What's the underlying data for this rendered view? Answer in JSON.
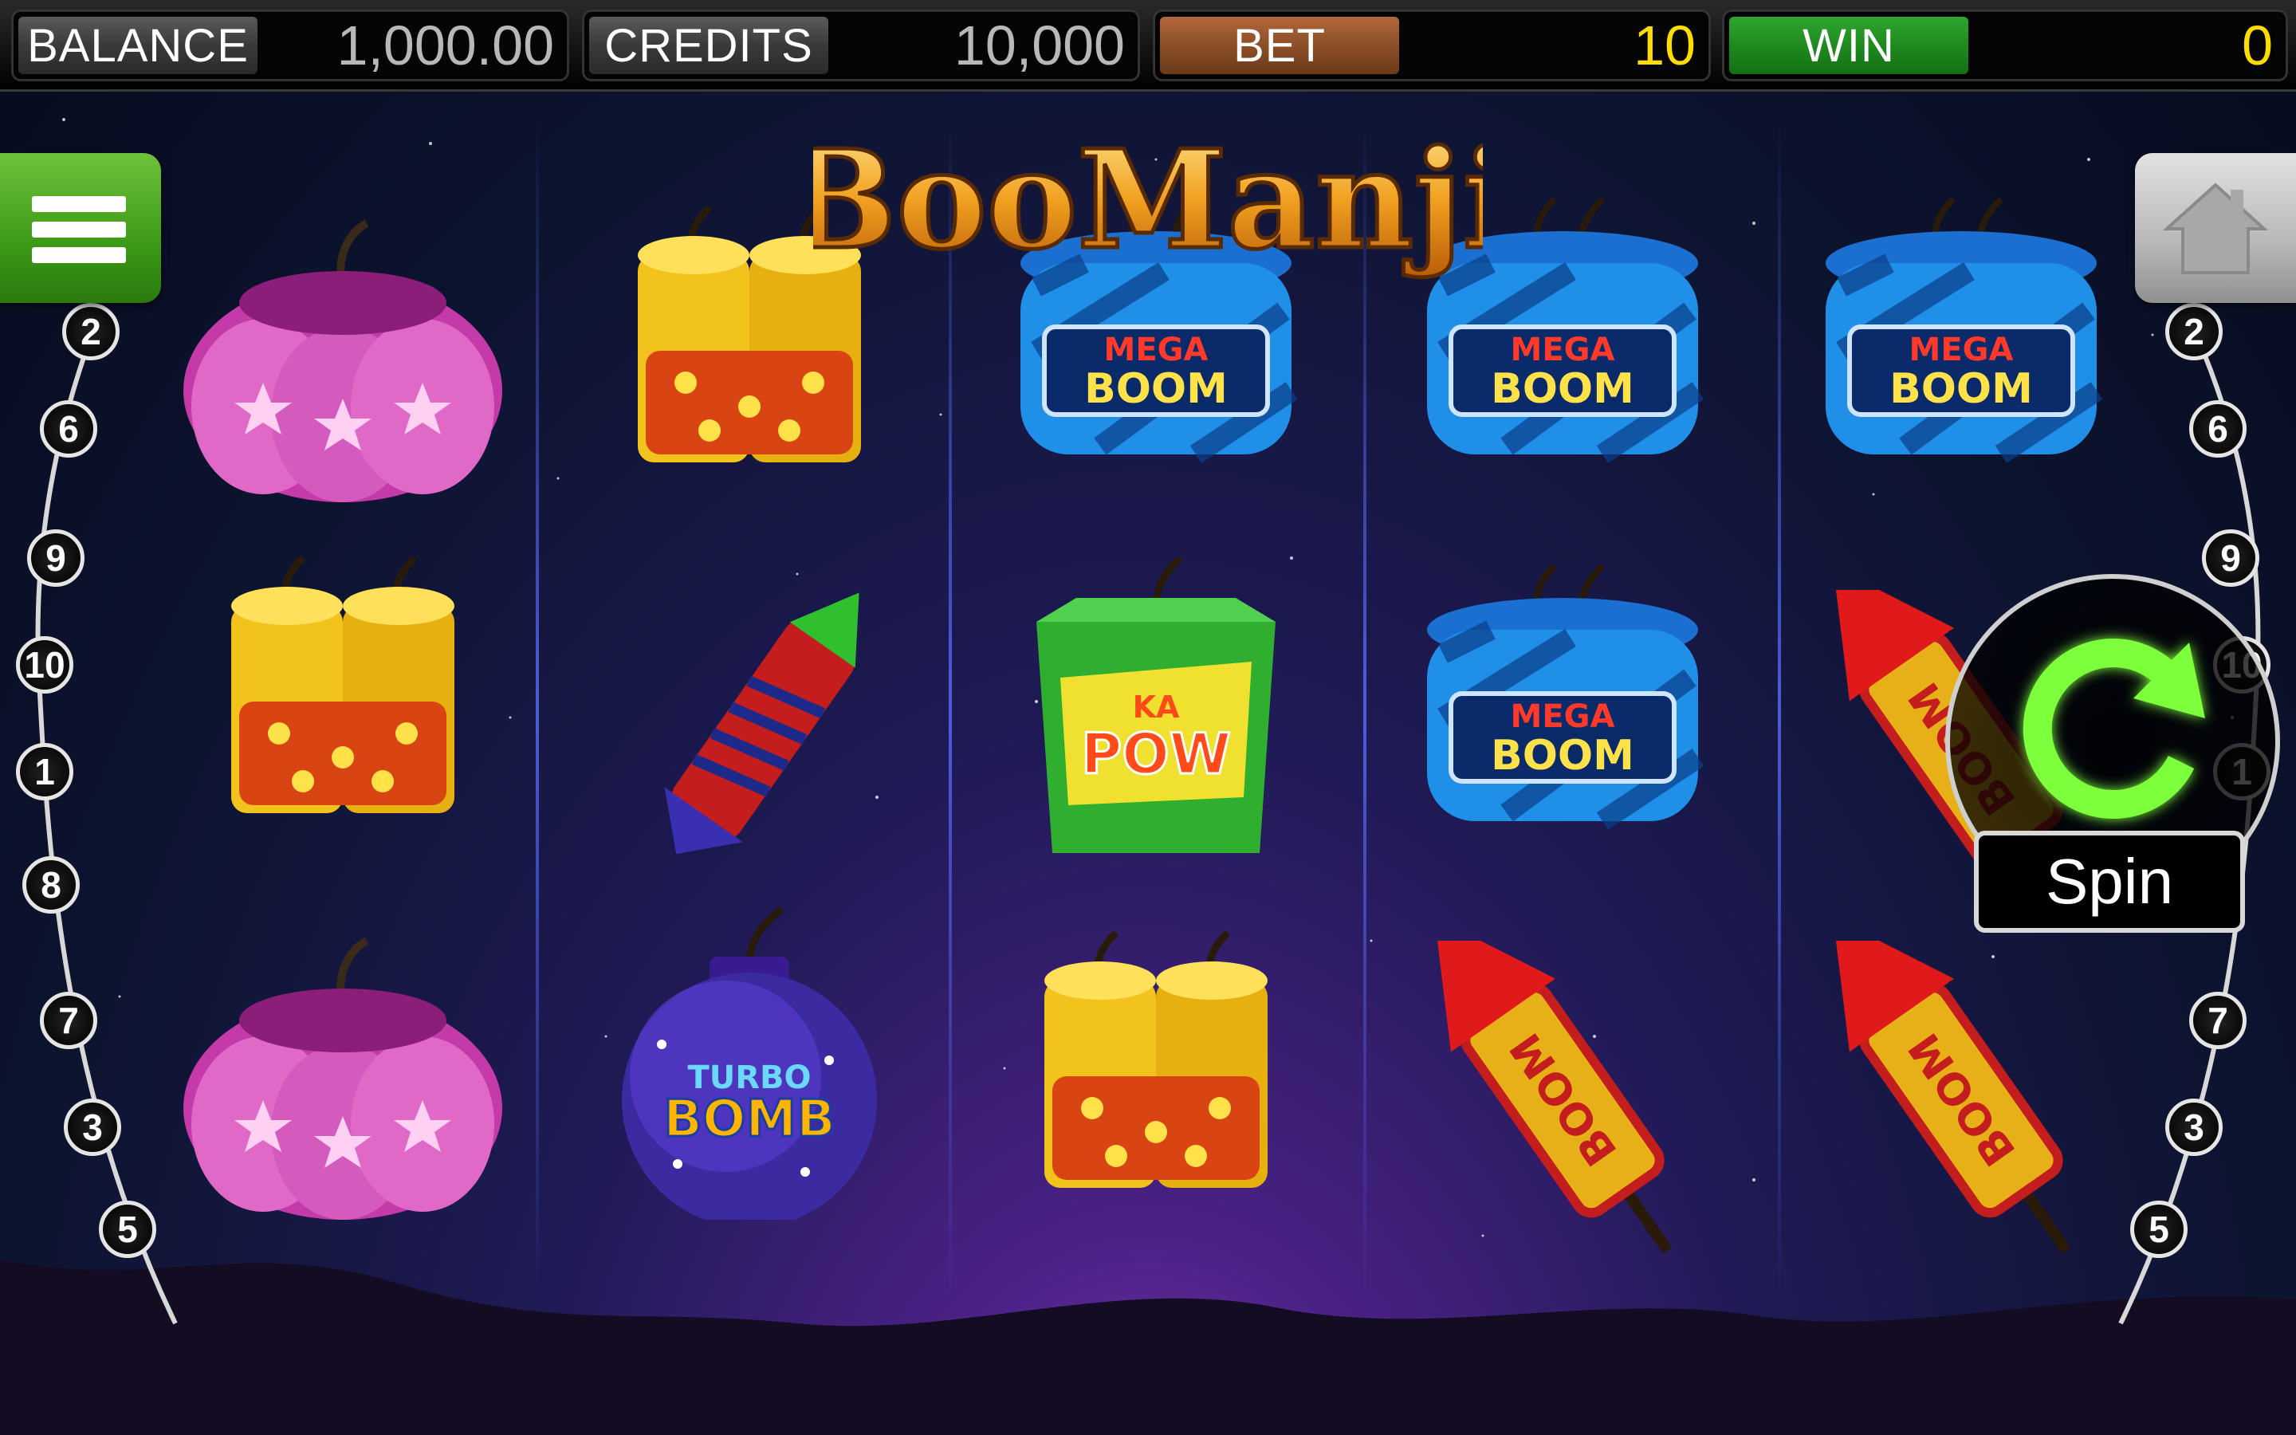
{
  "meters": {
    "balance": {
      "label": "BALANCE",
      "value": "1,000.00"
    },
    "credits": {
      "label": "CREDITS",
      "value": "10,000"
    },
    "bet": {
      "label": "BET",
      "value": "10"
    },
    "win": {
      "label": "WIN",
      "value": "0"
    }
  },
  "logo": {
    "text": "BooManji"
  },
  "paylines_left": [
    "2",
    "6",
    "9",
    "10",
    "1",
    "8",
    "7",
    "3",
    "5"
  ],
  "paylines_right": [
    "2",
    "6",
    "9",
    "10",
    "1",
    "7",
    "3",
    "5"
  ],
  "spin": {
    "label": "Spin"
  },
  "symbols": {
    "mega_boom": [
      "MEGA",
      "BOOM"
    ],
    "kapow": [
      "KA",
      "POW"
    ],
    "turbo_bomb": [
      "TURBO",
      "BOMB"
    ],
    "boom_rocket": "BOOM"
  },
  "colors": {
    "balance_label": "#4a4a4a",
    "bet_label": "#8c4f27",
    "win_label": "#1f8a1f",
    "value_grey": "#b8b8b8",
    "value_yellow": "#ffdd00",
    "menu_green": "#3d9a18"
  },
  "reels": [
    [
      "pink-star-cracker",
      "yellow-firecracker-pair",
      "pink-star-cracker"
    ],
    [
      "yellow-firecracker-pair",
      "red-rocket",
      "turbo-bomb"
    ],
    [
      "mega-boom-drum",
      "kapow-box",
      "yellow-firecracker-pair"
    ],
    [
      "mega-boom-drum",
      "mega-boom-drum",
      "boom-rocket"
    ],
    [
      "mega-boom-drum",
      "boom-rocket",
      "boom-rocket"
    ]
  ]
}
